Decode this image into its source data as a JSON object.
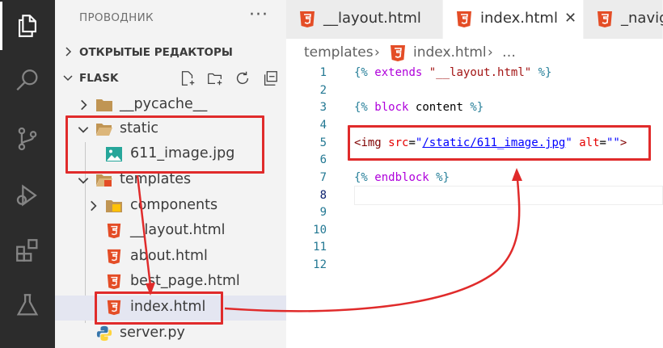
{
  "explorer": {
    "title": "ПРОВОДНИК",
    "more": "···",
    "open_editors": "ОТКРЫТЫЕ РЕДАКТОРЫ",
    "folder": "FLASK",
    "tree": [
      {
        "label": "__pycache__",
        "kind": "folder",
        "expanded": false
      },
      {
        "label": "static",
        "kind": "folder",
        "expanded": true
      },
      {
        "label": "611_image.jpg",
        "kind": "image"
      },
      {
        "label": "templates",
        "kind": "folder-templates",
        "expanded": true
      },
      {
        "label": "components",
        "kind": "folder-components",
        "expanded": false
      },
      {
        "label": "__layout.html",
        "kind": "html"
      },
      {
        "label": "about.html",
        "kind": "html"
      },
      {
        "label": "best_page.html",
        "kind": "html"
      },
      {
        "label": "index.html",
        "kind": "html",
        "selected": true
      },
      {
        "label": "server.py",
        "kind": "python"
      }
    ]
  },
  "tabs": [
    {
      "label": "__layout.html",
      "active": false
    },
    {
      "label": "index.html",
      "active": true,
      "close": "✕"
    },
    {
      "label": "_navig",
      "active": false
    }
  ],
  "breadcrumb": {
    "folder": "templates",
    "file": "index.html",
    "sep": "›",
    "more": "…"
  },
  "editor": {
    "line_numbers": [
      "1",
      "2",
      "3",
      "4",
      "5",
      "6",
      "7",
      "8",
      "9",
      "10",
      "11",
      "12"
    ],
    "lines": {
      "l1": {
        "open": "{%",
        "kw": "extends",
        "str": "\"__layout.html\"",
        "close": "%}"
      },
      "l3": {
        "open": "{%",
        "kw": "block",
        "name": "content",
        "close": "%}"
      },
      "l5": {
        "lt": "<",
        "tag": "img",
        "attr1": "src",
        "eq": "=",
        "q1": "\"",
        "val1": "/static/611_image.jpg",
        "q2": "\"",
        "attr2": "alt",
        "val2": "\"\"",
        "gt": ">"
      },
      "l7": {
        "open": "{%",
        "kw": "endblock",
        "close": "%}"
      }
    }
  },
  "colors": {
    "activity_bar": "#2c2c2c",
    "sidebar": "#f3f3f3",
    "annotation": "#e02b2b",
    "html_icon": "#e44d26"
  },
  "icons": [
    "files-icon",
    "search-icon",
    "source-control-icon",
    "run-debug-icon",
    "extensions-icon",
    "testing-icon",
    "new-file-icon",
    "new-folder-icon",
    "refresh-icon",
    "collapse-all-icon"
  ]
}
